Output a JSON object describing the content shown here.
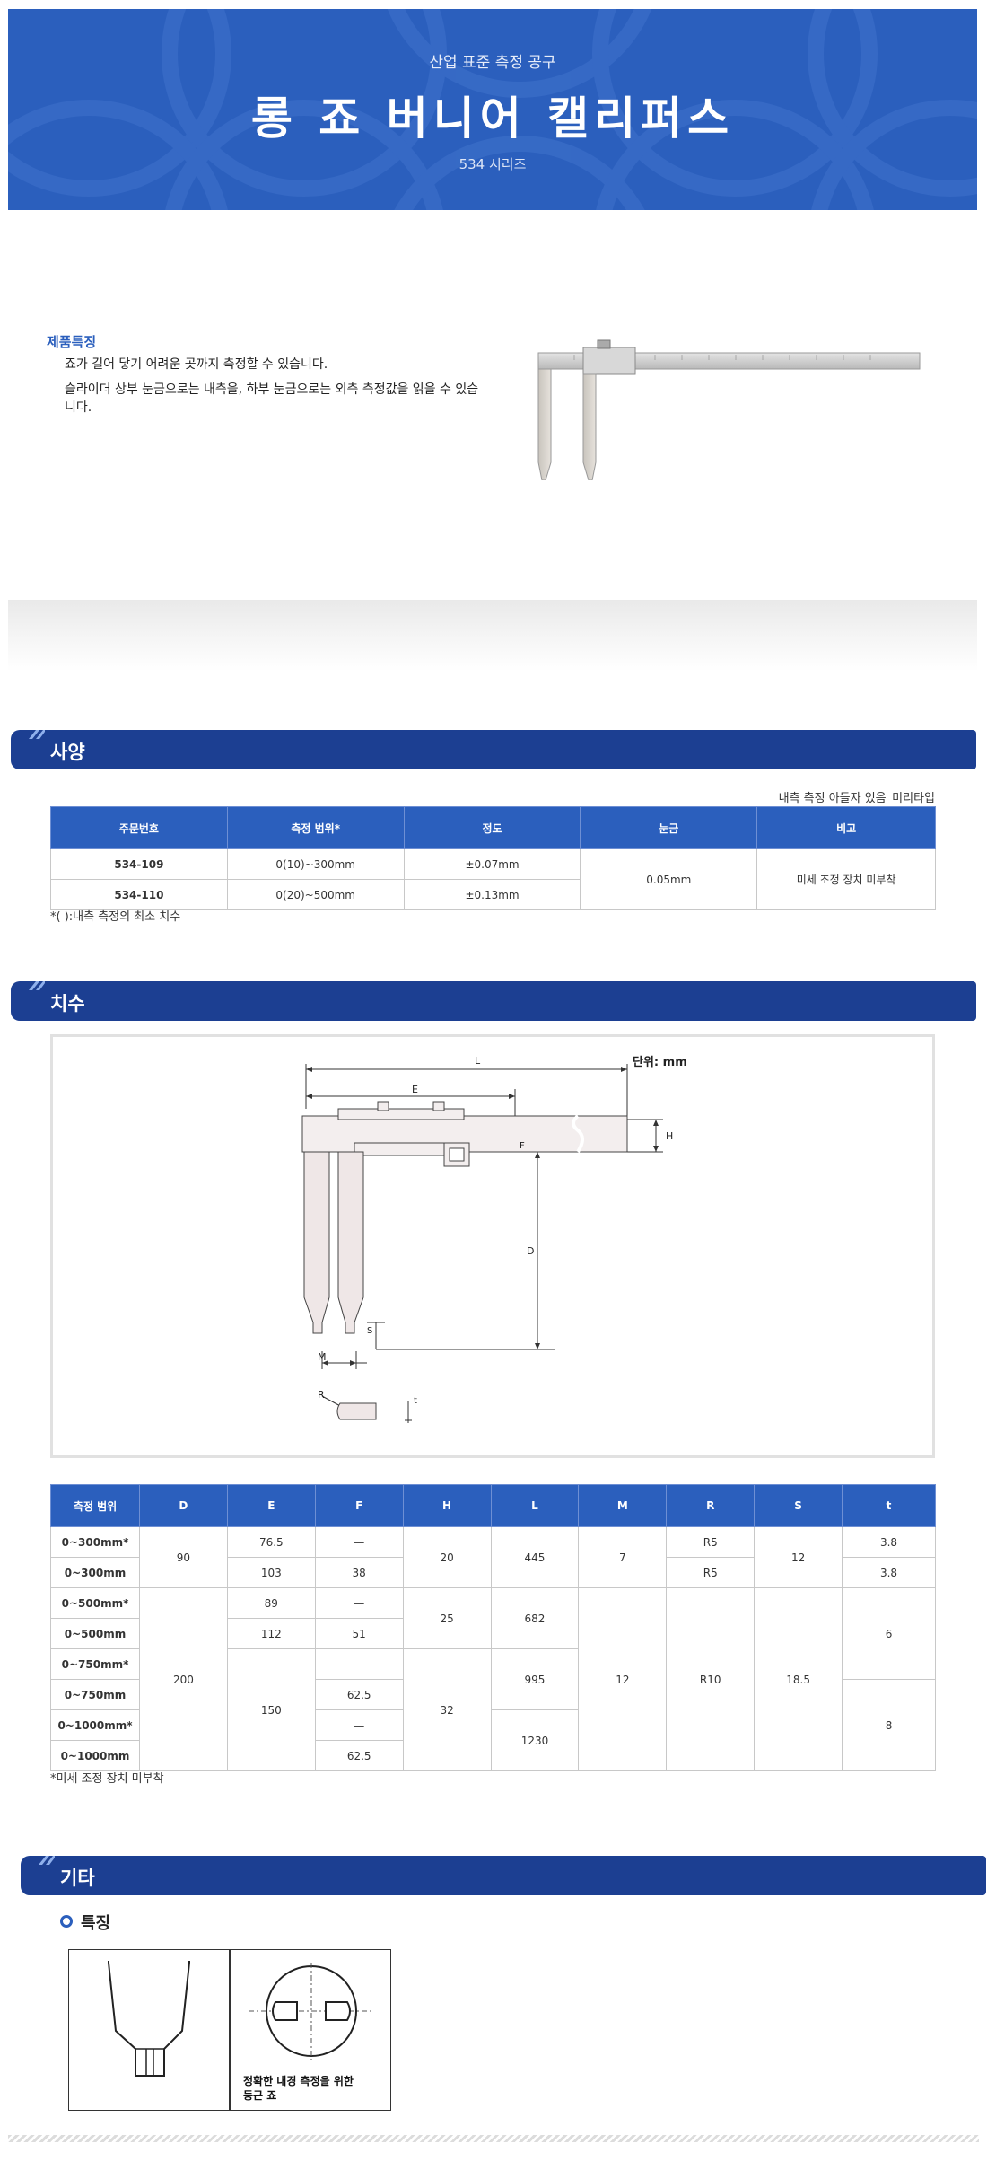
{
  "banner": {
    "subtitle": "산업 표준 측정 공구",
    "title": "롱 죠 버니어 캘리퍼스",
    "series": "534 시리즈"
  },
  "features": {
    "heading": "제품특징",
    "lines": [
      "죠가 길어 닿기 어려운 곳까지 측정할 수 있습니다.",
      "슬라이더 상부 눈금으로는 내측을, 하부 눈금으로는 외측 측정값을 읽을 수 있습니다."
    ]
  },
  "spec": {
    "section_label": "사양",
    "note_right": "내측 측정 아들자 있음_미리타입",
    "headers": [
      "주문번호",
      "측정 범위*",
      "정도",
      "눈금",
      "비고"
    ],
    "rows": [
      {
        "code": "534-109",
        "range": "0(10)~300mm",
        "accuracy": "±0.07mm"
      },
      {
        "code": "534-110",
        "range": "0(20)~500mm",
        "accuracy": "±0.13mm"
      }
    ],
    "graduation": "0.05mm",
    "remark": "미세 조정 장치 미부착",
    "footnote": "*( ):내측 측정의 최소 치수"
  },
  "dims": {
    "section_label": "치수",
    "unit": "단위: mm",
    "labels": {
      "L": "L",
      "E": "E",
      "H": "H",
      "F": "F",
      "D": "D",
      "S": "S",
      "M": "M",
      "R": "R",
      "t": "t"
    },
    "headers": [
      "측정 범위",
      "D",
      "E",
      "F",
      "H",
      "L",
      "M",
      "R",
      "S",
      "t"
    ],
    "ranges": [
      "0~300mm*",
      "0~300mm",
      "0~500mm*",
      "0~500mm",
      "0~750mm*",
      "0~750mm",
      "0~1000mm*",
      "0~1000mm"
    ],
    "D": [
      "90",
      "200"
    ],
    "E": [
      "76.5",
      "103",
      "89",
      "112",
      "150"
    ],
    "F": [
      "—",
      "38",
      "—",
      "51",
      "—",
      "62.5",
      "—",
      "62.5"
    ],
    "H": [
      "20",
      "25",
      "32"
    ],
    "L": [
      "445",
      "682",
      "995",
      "1230"
    ],
    "M": [
      "7",
      "12"
    ],
    "R": [
      "R5",
      "R5",
      "R10"
    ],
    "S": [
      "12",
      "18.5"
    ],
    "t": [
      "3.8",
      "3.8",
      "6",
      "8"
    ],
    "footnote": "*미세 조정 장치 미부착"
  },
  "other": {
    "section_label": "기타",
    "feature_heading": "특징",
    "caption_line1": "정확한 내경 측정을 위한",
    "caption_line2": "둥근 죠"
  }
}
